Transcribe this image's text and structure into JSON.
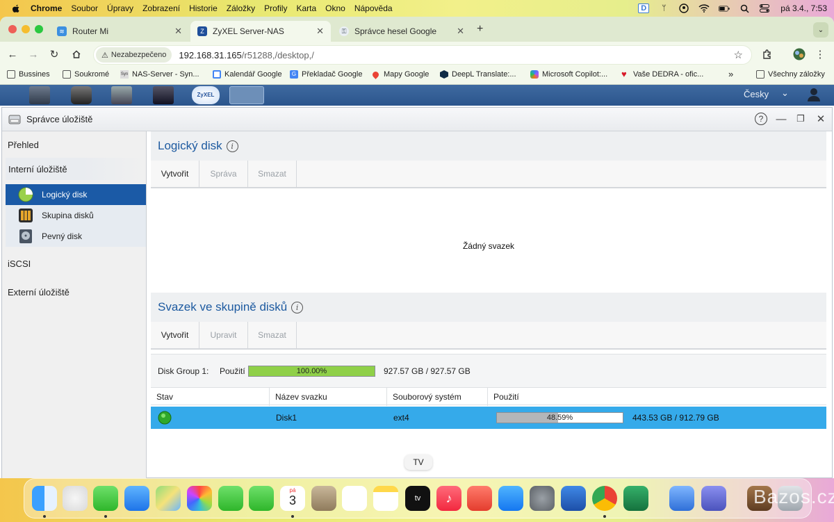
{
  "menubar": {
    "app": "Chrome",
    "items": [
      "Soubor",
      "Úpravy",
      "Zobrazení",
      "Historie",
      "Záložky",
      "Profily",
      "Karta",
      "Okno",
      "Nápověda"
    ],
    "clock": "pá 3.4.,  7:53",
    "status_icons": [
      "dictation-icon",
      "antenna-icon",
      "user-circle-icon",
      "wifi-icon",
      "battery-icon",
      "search-icon",
      "control-center-icon"
    ]
  },
  "browser": {
    "tabs": [
      {
        "title": "Router Mi",
        "icon": "wifi-icon"
      },
      {
        "title": "ZyXEL Server-NAS",
        "icon": "zyxel-icon",
        "active": true
      },
      {
        "title": "Správce hesel Google",
        "icon": "key-icon"
      }
    ],
    "new_tab": "+",
    "security_label": "Nezabezpečeno",
    "url_host": "192.168.31.165",
    "url_path": "/r51288,/desktop,/",
    "bookmarks": [
      {
        "label": "Bussines",
        "icon": "folder-icon"
      },
      {
        "label": "Soukromé",
        "icon": "folder-icon"
      },
      {
        "label": "NAS-Server - Syn...",
        "icon": "synology-icon"
      },
      {
        "label": "Kalendář Google",
        "icon": "calendar-icon"
      },
      {
        "label": "Překladač Google",
        "icon": "translate-icon"
      },
      {
        "label": "Mapy Google",
        "icon": "maps-icon"
      },
      {
        "label": "DeepL Translate:...",
        "icon": "deepl-icon"
      },
      {
        "label": "Microsoft Copilot:...",
        "icon": "copilot-icon"
      },
      {
        "label": "Vaše DEDRA - ofic...",
        "icon": "heart-icon"
      }
    ],
    "bookmarks_more": "»",
    "all_bookmarks": "Všechny záložky"
  },
  "nas": {
    "language": "Česky",
    "window_title": "Správce úložiště",
    "sidebar": {
      "overview": "Přehled",
      "internal": "Interní úložiště",
      "items": [
        {
          "label": "Logický disk",
          "selected": true
        },
        {
          "label": "Skupina disků"
        },
        {
          "label": "Pevný disk"
        }
      ],
      "iscsi": "iSCSI",
      "external": "Externí úložiště"
    },
    "logical": {
      "title": "Logický disk",
      "buttons": [
        "Vytvořit",
        "Správa",
        "Smazat"
      ],
      "empty_text": "Žádný svazek"
    },
    "group_volumes": {
      "title": "Svazek ve skupině disků",
      "buttons": [
        "Vytvořit",
        "Upravit",
        "Smazat"
      ],
      "disk_group_label": "Disk Group 1:",
      "usage_label": "Použití",
      "group_usage_percent": "100.00%",
      "group_usage_value": 1.0,
      "group_capacity": "927.57 GB / 927.57 GB",
      "columns": [
        "Stav",
        "Název svazku",
        "Souborový systém",
        "Použití"
      ],
      "rows": [
        {
          "status": "ok",
          "name": "Disk1",
          "fs": "ext4",
          "usage_percent": "48.59%",
          "usage_value": 0.4859,
          "capacity": "443.53 GB / 912.79 GB"
        }
      ]
    }
  },
  "dock": {
    "tooltip": "TV",
    "calendar_day": "pá",
    "calendar_date": "3",
    "apps": [
      "finder-icon",
      "launchpad-icon",
      "messages-icon",
      "mail-icon",
      "maps-icon",
      "photos-icon",
      "facetime-icon",
      "phone-icon",
      "calendar-icon",
      "contacts-icon",
      "reminders-icon",
      "notes-icon",
      "tv-icon",
      "music-icon",
      "rocket-icon",
      "app-store-icon",
      "settings-icon",
      "word-icon",
      "chrome-icon",
      "excel-icon",
      "ai-app-icon",
      "teams-icon",
      "downloads-icon",
      "trash-icon"
    ]
  },
  "watermark": "Bazos.cz"
}
